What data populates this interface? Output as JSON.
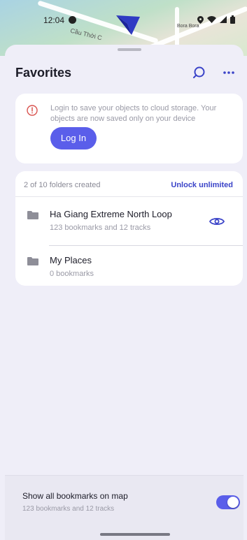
{
  "map": {
    "road_label": "Cầu Thời C",
    "place_label": "Bora Bora"
  },
  "status_bar": {
    "time": "12:04",
    "icons": [
      "location-icon",
      "wifi-icon",
      "signal-icon",
      "battery-icon"
    ]
  },
  "header": {
    "title": "Favorites",
    "search_icon": "search-icon",
    "more_icon": "more-icon"
  },
  "login_card": {
    "message": "Login to save your objects to cloud storage. Your objects are now saved only on your device",
    "button_label": "Log In",
    "warning_icon": "alert-circle-icon"
  },
  "folders": {
    "count_label": "2 of 10 folders created",
    "unlock_label": "Unlock unlimited",
    "items": [
      {
        "name": "Ha Giang Extreme North Loop",
        "subtitle": "123 bookmarks and 12 tracks",
        "visible_icon": "eye-icon"
      },
      {
        "name": "My Places",
        "subtitle": "0 bookmarks"
      }
    ]
  },
  "bottom_bar": {
    "title": "Show all bookmarks on map",
    "subtitle": "123 bookmarks and 12 tracks",
    "toggle_on": true
  },
  "colors": {
    "accent": "#5a5eea",
    "link": "#3a43c8",
    "background": "#efeef8",
    "warning": "#d9534f"
  }
}
